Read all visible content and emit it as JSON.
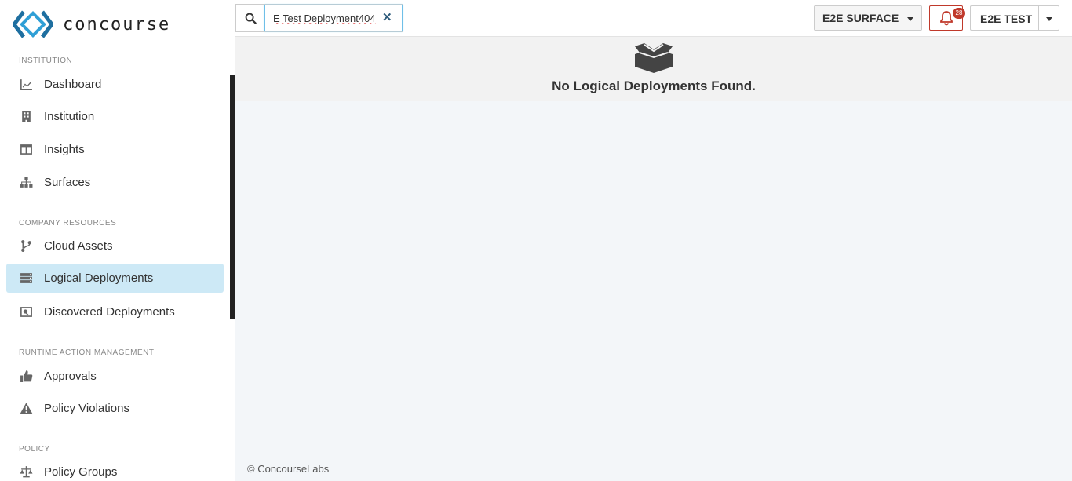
{
  "app": {
    "brand": "concourse"
  },
  "sidebar": {
    "sections": [
      {
        "label": "INSTITUTION"
      },
      {
        "label": "COMPANY RESOURCES"
      },
      {
        "label": "RUNTIME ACTION MANAGEMENT"
      },
      {
        "label": "POLICY"
      }
    ],
    "items": [
      {
        "label": "Dashboard",
        "icon": "chart-line-icon"
      },
      {
        "label": "Institution",
        "icon": "building-icon"
      },
      {
        "label": "Insights",
        "icon": "columns-icon"
      },
      {
        "label": "Surfaces",
        "icon": "sitemap-icon"
      },
      {
        "label": "Cloud Assets",
        "icon": "code-branch-icon"
      },
      {
        "label": "Logical Deployments",
        "icon": "server-icon",
        "active": true
      },
      {
        "label": "Discovered Deployments",
        "icon": "discovered-icon"
      },
      {
        "label": "Approvals",
        "icon": "thumbs-up-icon"
      },
      {
        "label": "Policy Violations",
        "icon": "warning-icon"
      },
      {
        "label": "Policy Groups",
        "icon": "balance-scale-icon"
      }
    ]
  },
  "topbar": {
    "search": {
      "value": "E Test Deployment404",
      "clear_symbol": "✕"
    },
    "surface_label": "E2E SURFACE",
    "notifications_count": "28",
    "user_label": "E2E TEST"
  },
  "main": {
    "empty_message": "No Logical Deployments Found."
  },
  "footer": {
    "copyright": "© ConcourseLabs"
  },
  "colors": {
    "accent": "#1e6fa0",
    "active_bg": "#cde9f6",
    "alert": "#c0392b"
  }
}
